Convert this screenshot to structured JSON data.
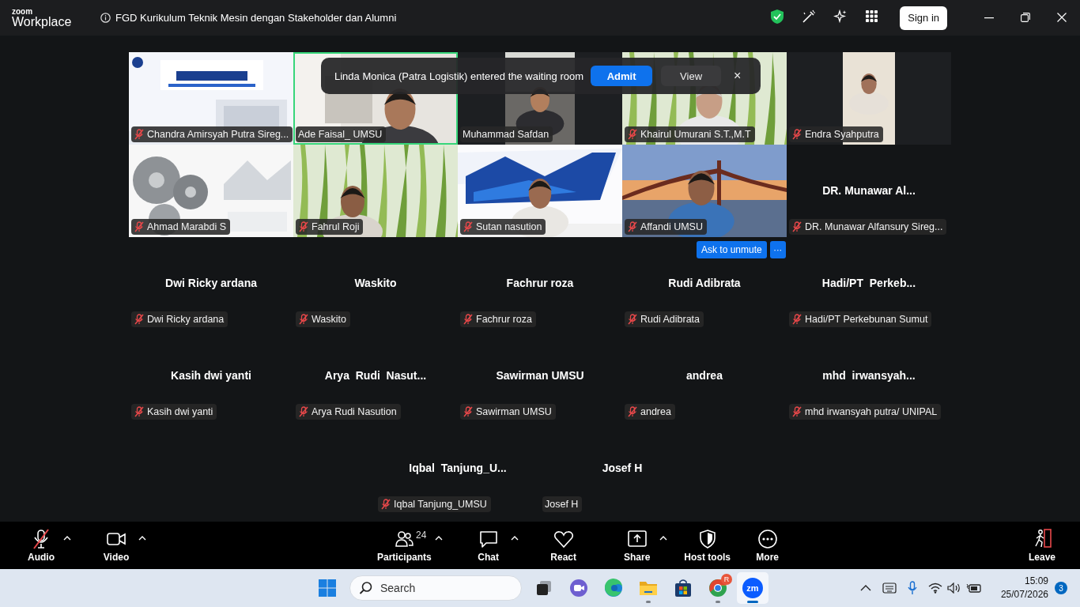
{
  "title_bar": {
    "logo_top": "zoom",
    "logo_bottom": "Workplace",
    "meeting_title": "FGD Kurikulum Teknik Mesin dengan Stakeholder dan Alumni",
    "sign_in": "Sign in"
  },
  "notification": {
    "message": "Linda Monica (Patra Logistik) entered the waiting room",
    "admit": "Admit",
    "view": "View",
    "close": "×"
  },
  "participants": [
    {
      "kind": "video",
      "name": "Chandra Amirsyah Putra Sireg...",
      "muted": true,
      "speaking": false
    },
    {
      "kind": "video",
      "name": "Ade Faisal_ UMSU",
      "muted": false,
      "speaking": true
    },
    {
      "kind": "video",
      "name": "Muhammad Safdan",
      "muted": false,
      "speaking": false
    },
    {
      "kind": "video",
      "name": "Khairul Umurani S.T.,M.T",
      "muted": true,
      "speaking": false
    },
    {
      "kind": "video",
      "name": "Endra Syahputra",
      "muted": true,
      "speaking": false
    },
    {
      "kind": "video",
      "name": "Ahmad Marabdi S",
      "muted": true,
      "speaking": false
    },
    {
      "kind": "video",
      "name": "Fahrul Roji",
      "muted": true,
      "speaking": false
    },
    {
      "kind": "video",
      "name": "Sutan nasution",
      "muted": true,
      "speaking": false
    },
    {
      "kind": "video",
      "name": "Affandi UMSU",
      "muted": true,
      "speaking": false
    },
    {
      "kind": "avatar",
      "display_name": "DR. Munawar Al...",
      "name": "DR. Munawar Alfansury Sireg...",
      "muted": true,
      "speaking": false
    },
    {
      "kind": "avatar",
      "display_name": "Dwi Ricky ardana",
      "name": "Dwi Ricky ardana",
      "muted": true,
      "speaking": false
    },
    {
      "kind": "avatar",
      "display_name": "Waskito",
      "name": "Waskito",
      "muted": true,
      "speaking": false
    },
    {
      "kind": "avatar",
      "display_name": "Fachrur roza",
      "name": "Fachrur roza",
      "muted": true,
      "speaking": false
    },
    {
      "kind": "avatar",
      "display_name": "Rudi Adibrata",
      "name": "Rudi Adibrata",
      "muted": true,
      "speaking": false
    },
    {
      "kind": "avatar",
      "display_name": "Hadi/PT  Perkeb...",
      "name": "Hadi/PT Perkebunan Sumut",
      "muted": true,
      "speaking": false
    },
    {
      "kind": "avatar",
      "display_name": "Kasih dwi yanti",
      "name": "Kasih dwi yanti",
      "muted": true,
      "speaking": false
    },
    {
      "kind": "avatar",
      "display_name": "Arya  Rudi  Nasut...",
      "name": "Arya Rudi Nasution",
      "muted": true,
      "speaking": false
    },
    {
      "kind": "avatar",
      "display_name": "Sawirman UMSU",
      "name": "Sawirman UMSU",
      "muted": true,
      "speaking": false
    },
    {
      "kind": "avatar",
      "display_name": "andrea",
      "name": "andrea",
      "muted": true,
      "speaking": false
    },
    {
      "kind": "avatar",
      "display_name": "mhd  irwansyah...",
      "name": "mhd irwansyah putra/ UNIPAL",
      "muted": true,
      "speaking": false
    },
    {
      "kind": "avatar",
      "display_name": "Iqbal  Tanjung_U...",
      "name": "Iqbal Tanjung_UMSU",
      "muted": true,
      "speaking": false
    },
    {
      "kind": "avatar",
      "display_name": "Josef H",
      "name": "Josef H",
      "muted": false,
      "speaking": false
    }
  ],
  "participant_menu": {
    "ask_to_unmute": "Ask to unmute",
    "more": "···"
  },
  "toolbar": {
    "items": [
      {
        "kind": "audio",
        "label": "Audio",
        "muted": true,
        "caret": true
      },
      {
        "kind": "video",
        "label": "Video",
        "caret": true
      },
      {
        "kind": "participants",
        "label": "Participants",
        "count": "24",
        "caret": true
      },
      {
        "kind": "chat",
        "label": "Chat",
        "caret": true
      },
      {
        "kind": "react",
        "label": "React",
        "caret": false
      },
      {
        "kind": "share",
        "label": "Share",
        "caret": true
      },
      {
        "kind": "host_tools",
        "label": "Host tools",
        "caret": false
      },
      {
        "kind": "more",
        "label": "More",
        "caret": false
      },
      {
        "kind": "leave",
        "label": "Leave",
        "caret": false
      }
    ]
  },
  "taskbar": {
    "search_placeholder": "Search",
    "apps": [
      {
        "kind": "taskview",
        "running": false,
        "selected": false
      },
      {
        "kind": "meet",
        "running": false,
        "selected": false
      },
      {
        "kind": "edge",
        "running": false,
        "selected": false
      },
      {
        "kind": "explorer",
        "running": true,
        "selected": false
      },
      {
        "kind": "store",
        "running": false,
        "selected": false
      },
      {
        "kind": "chrome",
        "badge": "R",
        "running": true,
        "selected": false
      },
      {
        "kind": "zoom",
        "label": "zm",
        "running": true,
        "selected": true
      }
    ],
    "time": "15:09",
    "date": "25/07/2026",
    "notifications": "3"
  }
}
